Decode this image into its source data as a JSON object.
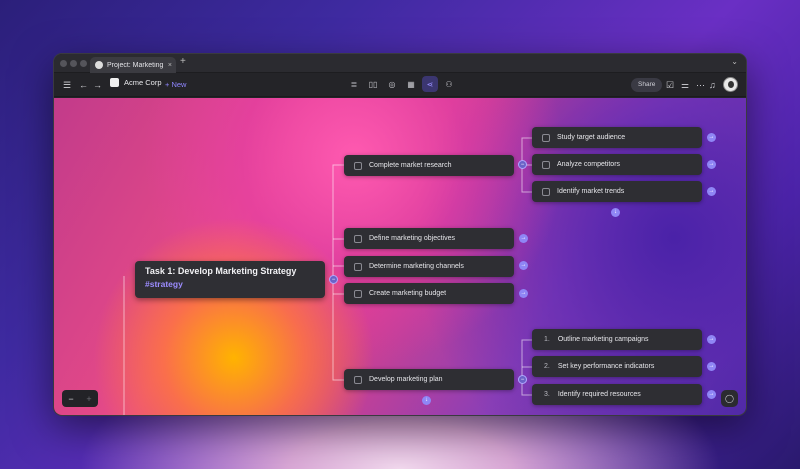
{
  "tab": {
    "title": "Project: Marketing Te...",
    "close": "×",
    "add": "+"
  },
  "toolbar": {
    "org_name": "Acme Corp",
    "new_label": "+ New",
    "share_label": "Share"
  },
  "root": {
    "title": "Task 1: Develop Marketing Strategy",
    "tag": "#strategy"
  },
  "branches": [
    "Complete market research",
    "Define marketing objectives",
    "Determine marketing channels",
    "Create marketing budget",
    "Develop marketing plan"
  ],
  "research_children": [
    "Study target audience",
    "Analyze competitors",
    "Identify market trends"
  ],
  "plan_children": [
    {
      "num": "1.",
      "label": "Outline marketing campaigns"
    },
    {
      "num": "2.",
      "label": "Set key performance indicators"
    },
    {
      "num": "3.",
      "label": "Identify required resources"
    }
  ],
  "zoom": {
    "minus": "−",
    "plus": "+"
  },
  "colors": {
    "accent": "#8f86f5",
    "card": "#2e2e33",
    "tag": "#9c8cff"
  },
  "icons": [
    "sidebar-toggle-icon",
    "back-arrow-icon",
    "forward-arrow-icon",
    "list-view-icon",
    "board-view-icon",
    "database-view-icon",
    "table-view-icon",
    "mindmap-view-icon",
    "share-nodes-icon",
    "checklist-icon",
    "filter-icon",
    "more-icon",
    "bell-icon",
    "chat-icon"
  ]
}
